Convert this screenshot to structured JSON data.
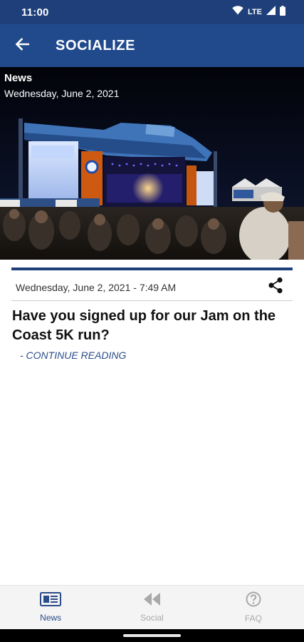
{
  "status_bar": {
    "time": "11:00",
    "network": "LTE",
    "icons": [
      "wifi-icon",
      "signal-icon",
      "battery-icon"
    ]
  },
  "app_bar": {
    "title": "SOCIALIZE",
    "back_icon": "arrow-left-icon"
  },
  "hero": {
    "label": "News",
    "date": "Wednesday, June 2, 2021"
  },
  "article": {
    "meta_date": "Wednesday, June 2, 2021 - 7:49 AM",
    "share_icon": "share-icon",
    "headline": "Have you signed up for our Jam on the Coast 5K run?",
    "continue_label": "- CONTINUE READING"
  },
  "bottom_nav": {
    "items": [
      {
        "label": "News",
        "icon": "newspaper-icon",
        "active": true
      },
      {
        "label": "Social",
        "icon": "rewind-icon",
        "active": false
      },
      {
        "label": "FAQ",
        "icon": "question-circle-icon",
        "active": false
      }
    ]
  },
  "colors": {
    "status_bar": "#1e3f7a",
    "app_bar": "#214a8d",
    "accent": "#2b4c8a",
    "inactive": "#a9a9a9"
  }
}
